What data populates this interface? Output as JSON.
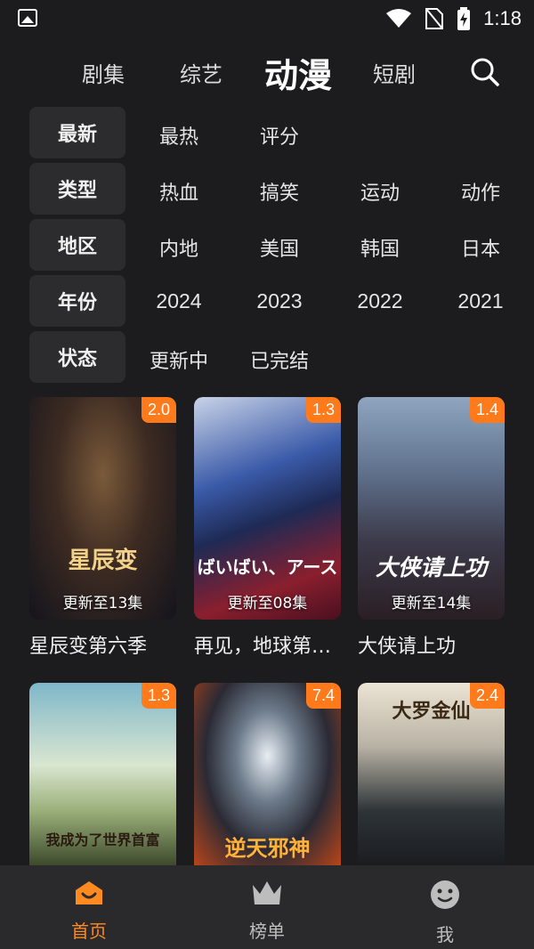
{
  "status_bar": {
    "time": "1:18"
  },
  "tabs": [
    {
      "label": "剧集",
      "active": false
    },
    {
      "label": "综艺",
      "active": false
    },
    {
      "label": "动漫",
      "active": true
    },
    {
      "label": "短剧",
      "active": false
    }
  ],
  "filters": [
    {
      "key": "最新",
      "options": [
        "最热",
        "评分"
      ]
    },
    {
      "key": "类型",
      "options": [
        "热血",
        "搞笑",
        "运动",
        "动作"
      ]
    },
    {
      "key": "地区",
      "options": [
        "内地",
        "美国",
        "韩国",
        "日本"
      ]
    },
    {
      "key": "年份",
      "options": [
        "2024",
        "2023",
        "2022",
        "2021"
      ]
    },
    {
      "key": "状态",
      "options": [
        "更新中",
        "已完结"
      ]
    }
  ],
  "cards": [
    {
      "title": "星辰变第六季",
      "score": "2.0",
      "update": "更新至13集",
      "art_text": "星辰变"
    },
    {
      "title": "再见，地球第…",
      "score": "1.3",
      "update": "更新至08集",
      "art_text": "ばいばい、アース"
    },
    {
      "title": "大侠请上功",
      "score": "1.4",
      "update": "更新至14集",
      "art_text": "大侠请上功"
    },
    {
      "title": "",
      "score": "1.3",
      "update": "",
      "art_text": "我成为了世界首富"
    },
    {
      "title": "",
      "score": "7.4",
      "update": "",
      "art_text": "逆天邪神"
    },
    {
      "title": "",
      "score": "2.4",
      "update": "",
      "art_text": "大罗金仙"
    }
  ],
  "bottom_nav": [
    {
      "label": "首页",
      "icon": "home-icon",
      "active": true
    },
    {
      "label": "榜单",
      "icon": "crown-icon",
      "active": false
    },
    {
      "label": "我",
      "icon": "smiley-icon",
      "active": false
    }
  ],
  "colors": {
    "accent": "#ff7a1a",
    "background": "#1c1c1e",
    "chip": "#2c2c2e",
    "nav": "#2a2a2c"
  }
}
